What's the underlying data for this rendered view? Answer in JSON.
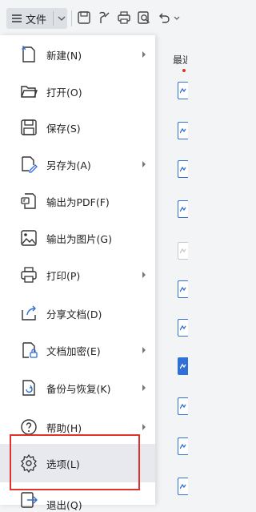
{
  "toolbar": {
    "file_label": "文件"
  },
  "menu": {
    "items": [
      {
        "label": "新建(N)",
        "icon": "new-document-icon",
        "submenu": true
      },
      {
        "label": "打开(O)",
        "icon": "folder-open-icon",
        "submenu": false
      },
      {
        "label": "保存(S)",
        "icon": "save-icon",
        "submenu": false
      },
      {
        "label": "另存为(A)",
        "icon": "save-as-icon",
        "submenu": true
      },
      {
        "label": "输出为PDF(F)",
        "icon": "export-pdf-icon",
        "submenu": false
      },
      {
        "label": "输出为图片(G)",
        "icon": "export-image-icon",
        "submenu": false
      },
      {
        "label": "打印(P)",
        "icon": "print-icon",
        "submenu": true
      },
      {
        "label": "分享文档(D)",
        "icon": "share-icon",
        "submenu": false
      },
      {
        "label": "文档加密(E)",
        "icon": "lock-document-icon",
        "submenu": true
      },
      {
        "label": "备份与恢复(K)",
        "icon": "backup-icon",
        "submenu": true
      },
      {
        "label": "帮助(H)",
        "icon": "help-icon",
        "submenu": true
      },
      {
        "label": "选项(L)",
        "icon": "gear-icon",
        "submenu": false,
        "selected": true
      },
      {
        "label": "退出(Q)",
        "icon": "exit-icon",
        "submenu": false
      }
    ]
  },
  "recent": {
    "label": "最近"
  },
  "colors": {
    "accent": "#2f6fd6",
    "highlight": "#e0312c"
  }
}
